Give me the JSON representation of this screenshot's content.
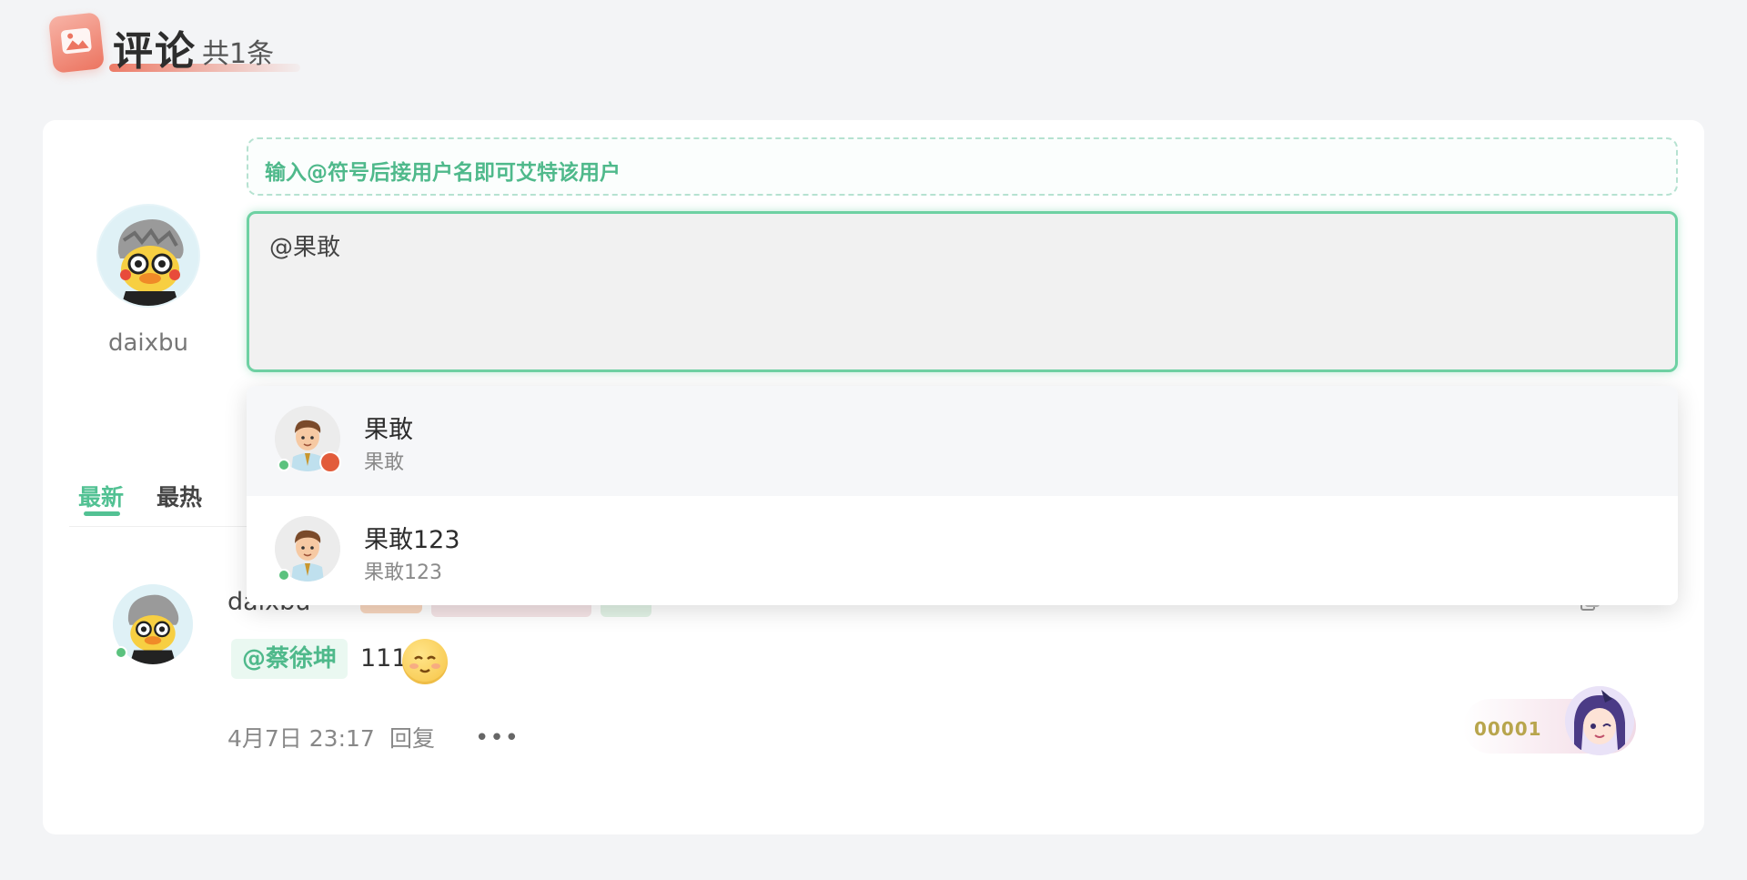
{
  "header": {
    "title": "评论",
    "count": "共1条"
  },
  "composer": {
    "username": "daixbu",
    "tip": "输入@符号后接用户名即可艾特该用户",
    "input_value": "@果敢"
  },
  "mention_dropdown": {
    "items": [
      {
        "name": "果敢",
        "sub": "果敢",
        "highlighted": true,
        "online": true
      },
      {
        "name": "果敢123",
        "sub": "果敢123",
        "highlighted": false,
        "online": true
      }
    ]
  },
  "tabs": [
    {
      "label": "最新",
      "active": true
    },
    {
      "label": "最热",
      "active": false
    }
  ],
  "comment": {
    "username": "daixbu",
    "mention": "@蔡徐坤",
    "text": "1111",
    "emoji": "smiling-face-icon",
    "time": "4月7日 23:17",
    "reply_label": "回复",
    "more_label": "•••",
    "fan_number": "00001"
  },
  "colors": {
    "accent": "#52c193",
    "accent_border": "#6ed1a3",
    "header_icon": "#ec7561",
    "online": "#5bc27e"
  }
}
